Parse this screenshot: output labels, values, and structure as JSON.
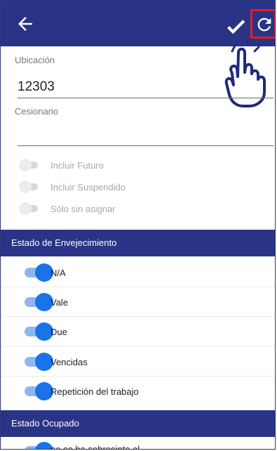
{
  "header": {
    "back_icon": "arrow-left-icon",
    "confirm_icon": "checkmark-icon",
    "refresh_icon": "refresh-icon",
    "color": "#2a3486",
    "highlight_color": "#e02020"
  },
  "form": {
    "location_label": "Ubicación",
    "location_value": "12303",
    "assignee_label": "Cesionario",
    "assignee_value": ""
  },
  "filters": [
    {
      "label": "Incluir Futuro",
      "enabled": false
    },
    {
      "label": "Incluir Suspendido",
      "enabled": false
    },
    {
      "label": "Sólo sin asignar",
      "enabled": false
    }
  ],
  "aging_section": {
    "title": "Estado de Envejecimiento",
    "items": [
      {
        "label": "N/A",
        "on": true
      },
      {
        "label": "Vale",
        "on": true
      },
      {
        "label": "Due",
        "on": true
      },
      {
        "label": "Vencidas",
        "on": true
      },
      {
        "label": "Repetición del trabajo",
        "on": true
      }
    ]
  },
  "busy_section": {
    "title": "Estado Ocupado",
    "items": [
      {
        "label": "no se ha sobresinte el",
        "on": true
      }
    ]
  },
  "colors": {
    "accent": "#1a73e8",
    "accent_track": "#8fb7ef"
  }
}
